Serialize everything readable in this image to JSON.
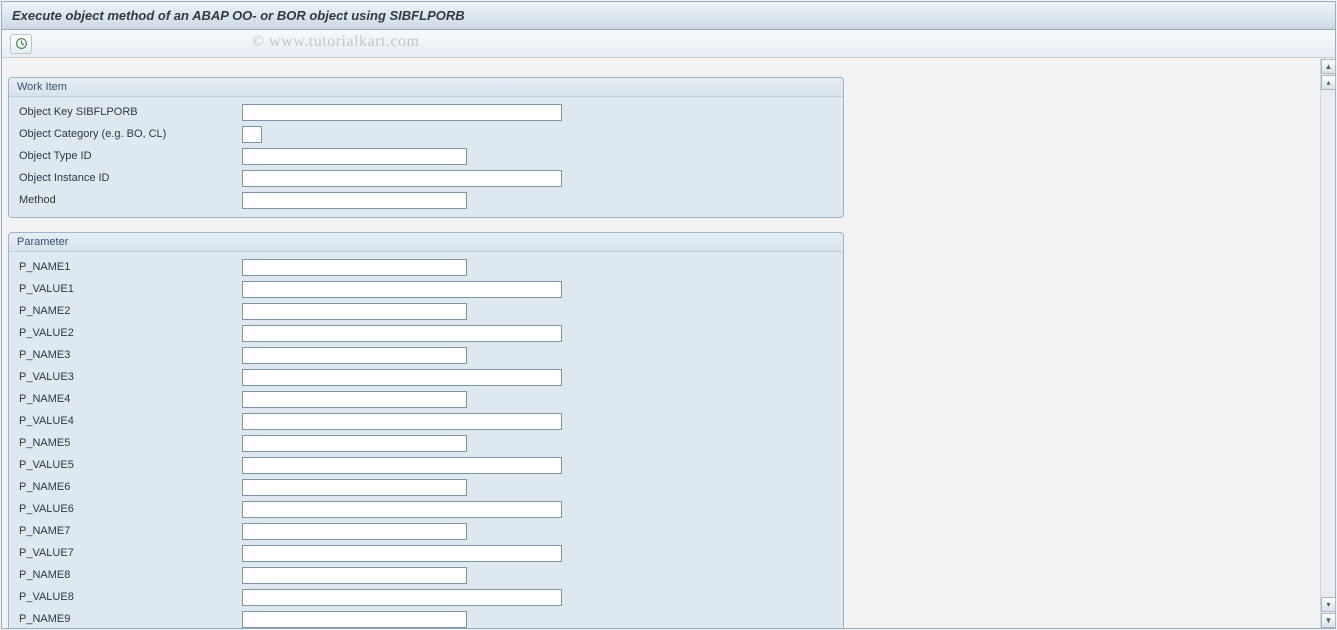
{
  "header": {
    "title": "Execute object method of an ABAP OO- or BOR object using SIBFLPORB"
  },
  "watermark": "© www.tutorialkart.com",
  "toolbar": {
    "execute_tooltip": "Execute"
  },
  "workitem": {
    "legend": "Work Item",
    "fields": [
      {
        "label": "Object Key SIBFLPORB",
        "width": "md",
        "value": ""
      },
      {
        "label": "Object Category (e.g. BO, CL)",
        "width": "xs",
        "value": ""
      },
      {
        "label": "Object Type ID",
        "width": "sm",
        "value": ""
      },
      {
        "label": "Object Instance ID",
        "width": "md",
        "value": ""
      },
      {
        "label": "Method",
        "width": "sm",
        "value": ""
      }
    ]
  },
  "parameter": {
    "legend": "Parameter",
    "fields": [
      {
        "label": "P_NAME1",
        "width": "sm",
        "value": ""
      },
      {
        "label": "P_VALUE1",
        "width": "md",
        "value": ""
      },
      {
        "label": "P_NAME2",
        "width": "sm",
        "value": ""
      },
      {
        "label": "P_VALUE2",
        "width": "md",
        "value": ""
      },
      {
        "label": "P_NAME3",
        "width": "sm",
        "value": ""
      },
      {
        "label": "P_VALUE3",
        "width": "md",
        "value": ""
      },
      {
        "label": "P_NAME4",
        "width": "sm",
        "value": ""
      },
      {
        "label": "P_VALUE4",
        "width": "md",
        "value": ""
      },
      {
        "label": "P_NAME5",
        "width": "sm",
        "value": ""
      },
      {
        "label": "P_VALUE5",
        "width": "md",
        "value": ""
      },
      {
        "label": "P_NAME6",
        "width": "sm",
        "value": ""
      },
      {
        "label": "P_VALUE6",
        "width": "md",
        "value": ""
      },
      {
        "label": "P_NAME7",
        "width": "sm",
        "value": ""
      },
      {
        "label": "P_VALUE7",
        "width": "md",
        "value": ""
      },
      {
        "label": "P_NAME8",
        "width": "sm",
        "value": ""
      },
      {
        "label": "P_VALUE8",
        "width": "md",
        "value": ""
      },
      {
        "label": "P_NAME9",
        "width": "sm",
        "value": ""
      }
    ]
  }
}
